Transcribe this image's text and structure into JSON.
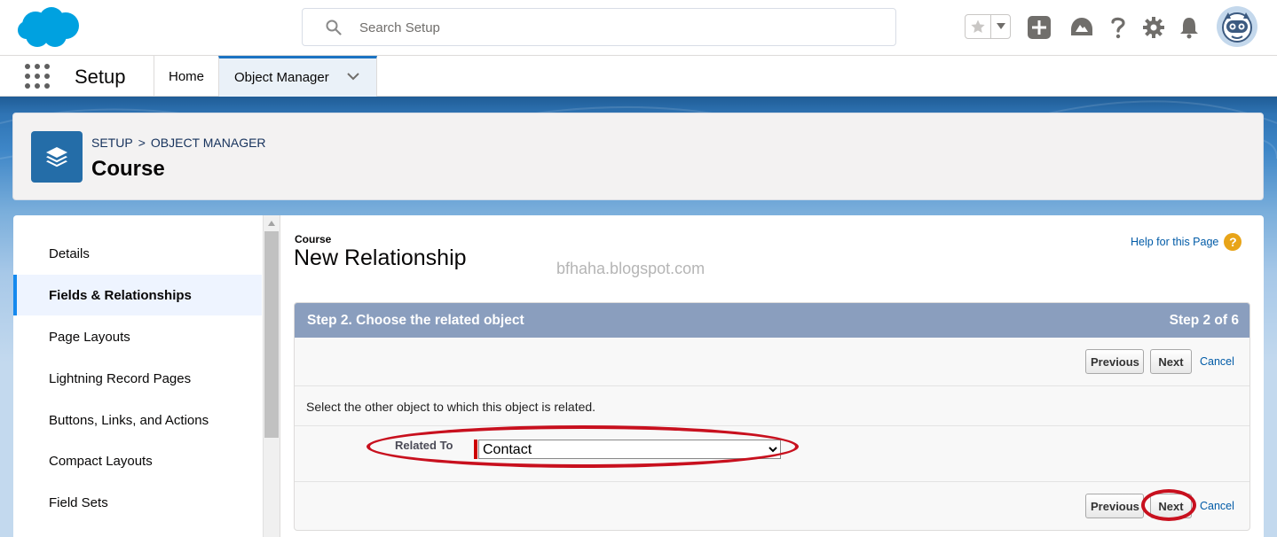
{
  "header": {
    "search_placeholder": "Search Setup",
    "icons": [
      "cloud-logo",
      "search-icon",
      "star-icon",
      "chevron-down-icon",
      "plus-icon",
      "trailhead-icon",
      "help-icon",
      "gear-icon",
      "bell-icon",
      "avatar"
    ]
  },
  "context_bar": {
    "app_name": "Setup",
    "tabs": [
      {
        "label": "Home"
      },
      {
        "label": "Object Manager"
      }
    ]
  },
  "object_header": {
    "breadcrumb": [
      "SETUP",
      "OBJECT MANAGER"
    ],
    "separator": ">",
    "title": "Course"
  },
  "sidebar": {
    "items": [
      {
        "label": "Details",
        "active": false
      },
      {
        "label": "Fields & Relationships",
        "active": true
      },
      {
        "label": "Page Layouts",
        "active": false
      },
      {
        "label": "Lightning Record Pages",
        "active": false
      },
      {
        "label": "Buttons, Links, and Actions",
        "active": false
      },
      {
        "label": "Compact Layouts",
        "active": false
      },
      {
        "label": "Field Sets",
        "active": false
      }
    ]
  },
  "main": {
    "object_name": "Course",
    "page_title": "New Relationship",
    "watermark": "bfhaha.blogspot.com",
    "help_link": "Help for this Page",
    "wizard": {
      "step_title": "Step 2. Choose the related object",
      "step_count": "Step 2 of 6",
      "previous_label": "Previous",
      "next_label": "Next",
      "cancel_label": "Cancel",
      "description": "Select the other object to which this object is related.",
      "field_label": "Related To",
      "field_value": "Contact"
    }
  },
  "colors": {
    "brand_blue": "#1b73c2",
    "object_icon": "#246da8",
    "wizard_header": "#8a9ebe",
    "annotation_red": "#c8101e"
  }
}
